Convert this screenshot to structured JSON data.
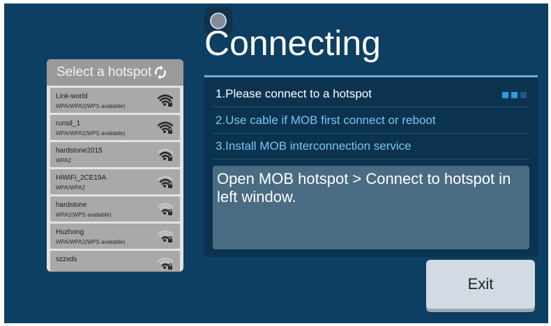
{
  "title": "Connecting",
  "hotspot_panel": {
    "header": "Select a hotspot",
    "items": [
      {
        "name": "Link-world",
        "security": "WPA/WPA2(WPS available)",
        "signal": 3
      },
      {
        "name": "runsil_1",
        "security": "WPA/WPA2(WPS available)",
        "signal": 3
      },
      {
        "name": "hardstone2015",
        "security": "WPA2",
        "signal": 2
      },
      {
        "name": "HiWiFi_2CE19A",
        "security": "WPA/WPA2",
        "signal": 2
      },
      {
        "name": "hardstone",
        "security": "WPA2(WPS available)",
        "signal": 1
      },
      {
        "name": "Huzhong",
        "security": "WPA/WPA2(WPS available)",
        "signal": 1
      },
      {
        "name": "szzxds",
        "security": "",
        "signal": 1
      }
    ]
  },
  "steps": [
    {
      "label": "1.Please connect to a hotspot",
      "active": true
    },
    {
      "label": "2.Use cable if MOB first connect or reboot",
      "active": false
    },
    {
      "label": "3.Install MOB interconnection service",
      "active": false
    }
  ],
  "progress": {
    "total": 3,
    "current": 2
  },
  "message": "Open MOB hotspot > Connect to hotspot in left window.",
  "exit_label": "Exit",
  "colors": {
    "background": "#0d3f62",
    "accent": "#5fb7e8",
    "step_inactive": "#7cc5ee",
    "dot_active": "#2e9bd6",
    "dot_inactive": "#1c5a82"
  },
  "icons": {
    "float": "assistive-touch-icon",
    "refresh": "refresh-icon",
    "wifi": "wifi-lock-icon"
  }
}
